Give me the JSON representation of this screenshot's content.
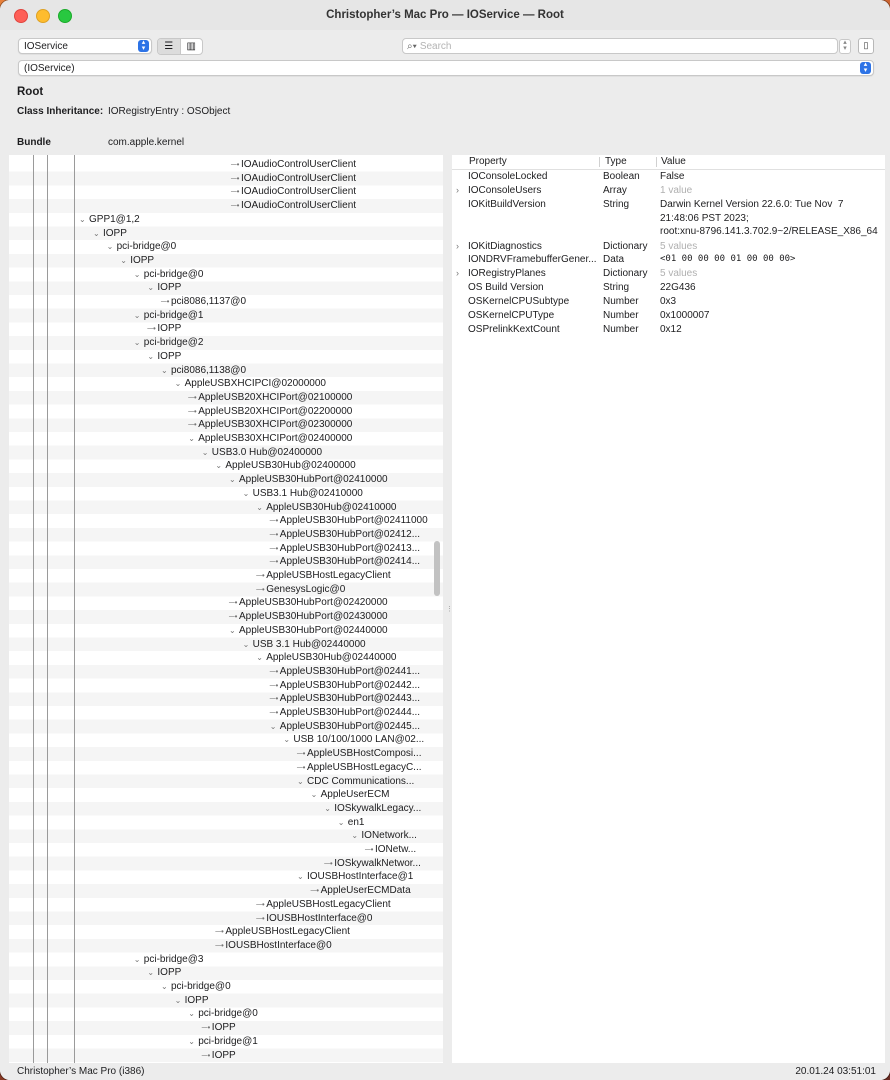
{
  "window": {
    "title": "Christopher’s Mac Pro — IOService — Root"
  },
  "toolbar": {
    "plane_select": "IOService",
    "search_placeholder": "Search",
    "path_select": "(IOService)"
  },
  "info": {
    "name": "Root",
    "inheritance_label": "Class Inheritance:",
    "inheritance_value": "IORegistryEntry : OSObject",
    "bundle_label": "Bundle",
    "bundle_value": "com.apple.kernel"
  },
  "tree": [
    {
      "label": "IOAudioControlUserClient",
      "depth": 0
    },
    {
      "label": "IOAudioControlUserClient",
      "depth": 0
    },
    {
      "label": "IOAudioControlUserClient",
      "depth": 0
    },
    {
      "label": "IOAudioControlUserClient",
      "depth": 0
    },
    {
      "label": "GPP1@1,2",
      "depth": -1
    },
    {
      "label": "IOPP",
      "depth": 0
    },
    {
      "label": "pci-bridge@0",
      "depth": 1
    },
    {
      "label": "IOPP",
      "depth": 2
    },
    {
      "label": "pci-bridge@0",
      "depth": 3
    },
    {
      "label": "IOPP",
      "depth": 4
    },
    {
      "label": "pci8086,1137@0",
      "depth": 5
    },
    {
      "label": "pci-bridge@1",
      "depth": 3
    },
    {
      "label": "IOPP",
      "depth": 4
    },
    {
      "label": "pci-bridge@2",
      "depth": 3
    },
    {
      "label": "IOPP",
      "depth": 4
    },
    {
      "label": "pci8086,1138@0",
      "depth": 5
    },
    {
      "label": "AppleUSBXHCIPCI@02000000",
      "depth": 6
    },
    {
      "label": "AppleUSB20XHCIPort@02100000",
      "depth": 7
    },
    {
      "label": "AppleUSB20XHCIPort@02200000",
      "depth": 7
    },
    {
      "label": "AppleUSB30XHCIPort@02300000",
      "depth": 7
    },
    {
      "label": "AppleUSB30XHCIPort@02400000",
      "depth": 7
    },
    {
      "label": "USB3.0 Hub@02400000",
      "depth": 8
    },
    {
      "label": "AppleUSB30Hub@02400000",
      "depth": 9
    },
    {
      "label": "AppleUSB30HubPort@02410000",
      "depth": 10
    },
    {
      "label": "USB3.1 Hub@02410000",
      "depth": 11
    },
    {
      "label": "AppleUSB30Hub@02410000",
      "depth": 12
    },
    {
      "label": "AppleUSB30HubPort@02411000",
      "depth": 13
    },
    {
      "label": "AppleUSB30HubPort@02412...",
      "depth": 13
    },
    {
      "label": "AppleUSB30HubPort@02413...",
      "depth": 13
    },
    {
      "label": "AppleUSB30HubPort@02414...",
      "depth": 13
    },
    {
      "label": "AppleUSBHostLegacyClient",
      "depth": 12
    },
    {
      "label": "GenesysLogic@0",
      "depth": 12
    },
    {
      "label": "AppleUSB30HubPort@02420000",
      "depth": 10
    },
    {
      "label": "AppleUSB30HubPort@02430000",
      "depth": 10
    },
    {
      "label": "AppleUSB30HubPort@02440000",
      "depth": 10
    },
    {
      "label": "USB 3.1 Hub@02440000",
      "depth": 11
    },
    {
      "label": "AppleUSB30Hub@02440000",
      "depth": 12
    },
    {
      "label": "AppleUSB30HubPort@02441...",
      "depth": 13
    },
    {
      "label": "AppleUSB30HubPort@02442...",
      "depth": 13
    },
    {
      "label": "AppleUSB30HubPort@02443...",
      "depth": 13
    },
    {
      "label": "AppleUSB30HubPort@02444...",
      "depth": 13
    },
    {
      "label": "AppleUSB30HubPort@02445...",
      "depth": 13
    },
    {
      "label": "USB 10/100/1000 LAN@02...",
      "depth": 14
    },
    {
      "label": "AppleUSBHostComposi...",
      "depth": 15
    },
    {
      "label": "AppleUSBHostLegacyC...",
      "depth": 15
    },
    {
      "label": "CDC Communications...",
      "depth": 15
    },
    {
      "label": "AppleUserECM",
      "depth": 16
    },
    {
      "label": "IOSkywalkLegacy...",
      "depth": 17
    },
    {
      "label": "en1",
      "depth": 18
    },
    {
      "label": "IONetwork...",
      "depth": 19
    },
    {
      "label": "IONetw...",
      "depth": 20
    },
    {
      "label": "IOSkywalkNetwor...",
      "depth": 17
    },
    {
      "label": "IOUSBHostInterface@1",
      "depth": 15
    },
    {
      "label": "AppleUserECMData",
      "depth": 16
    },
    {
      "label": "AppleUSBHostLegacyClient",
      "depth": 12
    },
    {
      "label": "IOUSBHostInterface@0",
      "depth": 12
    },
    {
      "label": "AppleUSBHostLegacyClient",
      "depth": 9
    },
    {
      "label": "IOUSBHostInterface@0",
      "depth": 9
    },
    {
      "label": "pci-bridge@3",
      "depth": 3
    },
    {
      "label": "IOPP",
      "depth": 4
    },
    {
      "label": "pci-bridge@0",
      "depth": 5
    },
    {
      "label": "IOPP",
      "depth": 6
    },
    {
      "label": "pci-bridge@0",
      "depth": 7
    },
    {
      "label": "IOPP",
      "depth": 8
    },
    {
      "label": "pci-bridge@1",
      "depth": 7
    },
    {
      "label": "IOPP",
      "depth": 8
    }
  ],
  "properties": {
    "headers": {
      "property": "Property",
      "type": "Type",
      "value": "Value"
    },
    "rows": [
      {
        "key": "IOConsoleLocked",
        "type": "Boolean",
        "value": "False",
        "toggle": false,
        "muted": false,
        "mono": false
      },
      {
        "key": "IOConsoleUsers",
        "type": "Array",
        "value": "1 value",
        "toggle": true,
        "muted": true,
        "mono": false
      },
      {
        "key": "IOKitBuildVersion",
        "type": "String",
        "value": "Darwin Kernel Version 22.6.0: Tue Nov  7\n21:48:06 PST 2023;\nroot:xnu-8796.141.3.702.9~2/RELEASE_X86_64",
        "toggle": false,
        "muted": false,
        "mono": false,
        "lines": 3
      },
      {
        "key": "IOKitDiagnostics",
        "type": "Dictionary",
        "value": "5 values",
        "toggle": true,
        "muted": true,
        "mono": false
      },
      {
        "key": "IONDRVFramebufferGener...",
        "type": "Data",
        "value": "<01 00 00 00 01 00 00 00>",
        "toggle": false,
        "muted": false,
        "mono": true
      },
      {
        "key": "IORegistryPlanes",
        "type": "Dictionary",
        "value": "5 values",
        "toggle": true,
        "muted": true,
        "mono": false
      },
      {
        "key": "OS Build Version",
        "type": "String",
        "value": "22G436",
        "toggle": false,
        "muted": false,
        "mono": false
      },
      {
        "key": "OSKernelCPUSubtype",
        "type": "Number",
        "value": "0x3",
        "toggle": false,
        "muted": false,
        "mono": false
      },
      {
        "key": "OSKernelCPUType",
        "type": "Number",
        "value": "0x1000007",
        "toggle": false,
        "muted": false,
        "mono": false
      },
      {
        "key": "OSPrelinkKextCount",
        "type": "Number",
        "value": "0x12",
        "toggle": false,
        "muted": false,
        "mono": false
      }
    ]
  },
  "status": {
    "left": "Christopher’s Mac Pro (i386)",
    "right": "20.01.24 03:51:01"
  }
}
